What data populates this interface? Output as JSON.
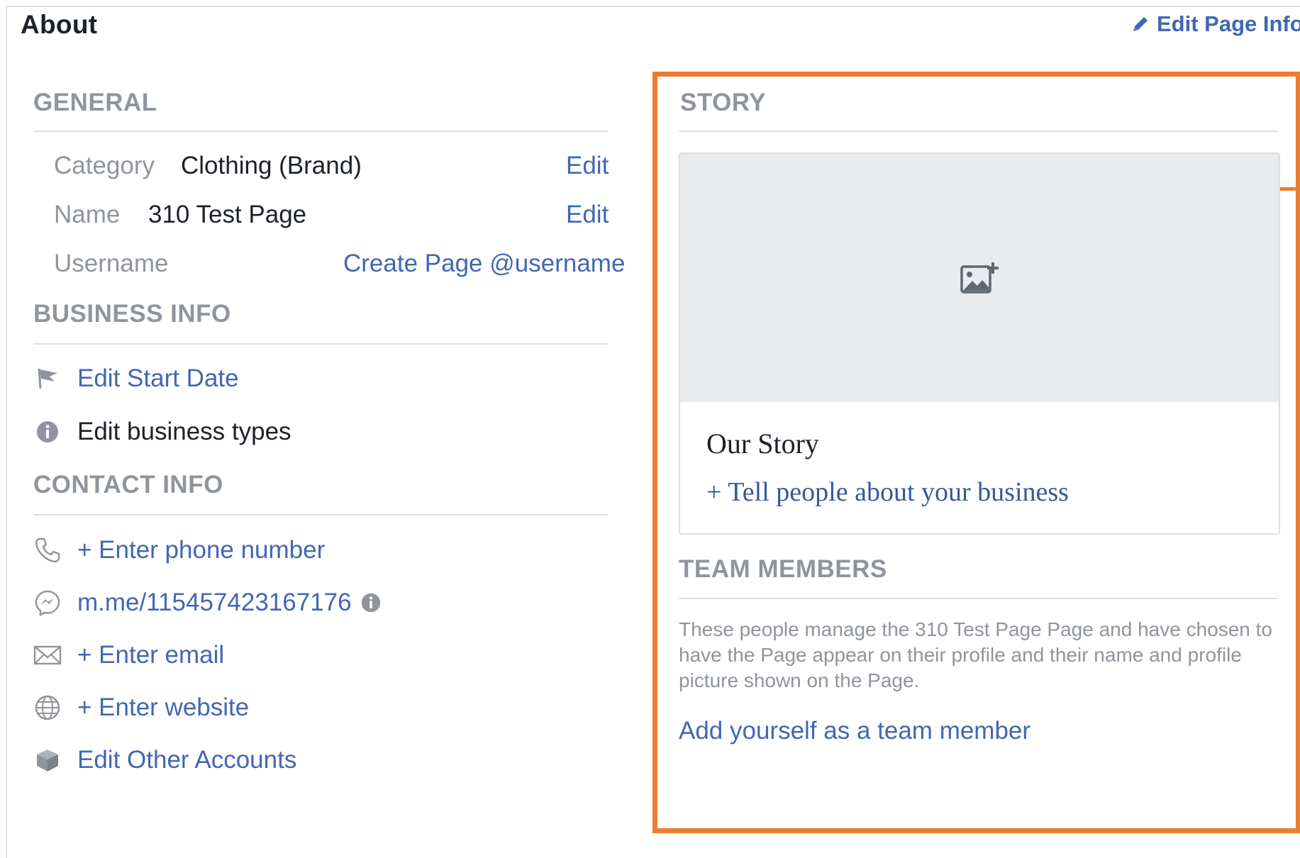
{
  "header": {
    "title": "About",
    "edit_page_info": "Edit Page Info"
  },
  "general": {
    "heading": "GENERAL",
    "rows": [
      {
        "label": "Category",
        "value": "Clothing (Brand)",
        "action": "Edit"
      },
      {
        "label": "Name",
        "value": "310 Test Page",
        "action": "Edit"
      },
      {
        "label": "Username",
        "value": "",
        "action": "Create Page @username"
      }
    ]
  },
  "business_info": {
    "heading": "BUSINESS INFO",
    "items": [
      {
        "icon": "flag-icon",
        "text": "Edit Start Date"
      },
      {
        "icon": "info-icon",
        "text": "Edit business types"
      }
    ]
  },
  "contact_info": {
    "heading": "CONTACT INFO",
    "items": [
      {
        "icon": "phone-icon",
        "text": "+ Enter phone number"
      },
      {
        "icon": "messenger-icon",
        "text": "m.me/115457423167176"
      },
      {
        "icon": "envelope-icon",
        "text": "+ Enter email"
      },
      {
        "icon": "globe-icon",
        "text": "+ Enter website"
      },
      {
        "icon": "cube-icon",
        "text": "Edit Other Accounts"
      }
    ]
  },
  "story": {
    "heading": "STORY",
    "card_title": "Our Story",
    "card_link": "+ Tell people about your business"
  },
  "team_members": {
    "heading": "TEAM MEMBERS",
    "description": "These people manage the 310 Test Page Page and have chosen to have the Page appear on their profile and their name and profile picture shown on the Page.",
    "add_link": "Add yourself as a team member"
  },
  "colors": {
    "link": "#4267b2",
    "heading_gray": "#90949c",
    "text_dark": "#1d2129",
    "highlight_orange": "#ec7d2f",
    "cover_gray": "#e9ebee"
  }
}
